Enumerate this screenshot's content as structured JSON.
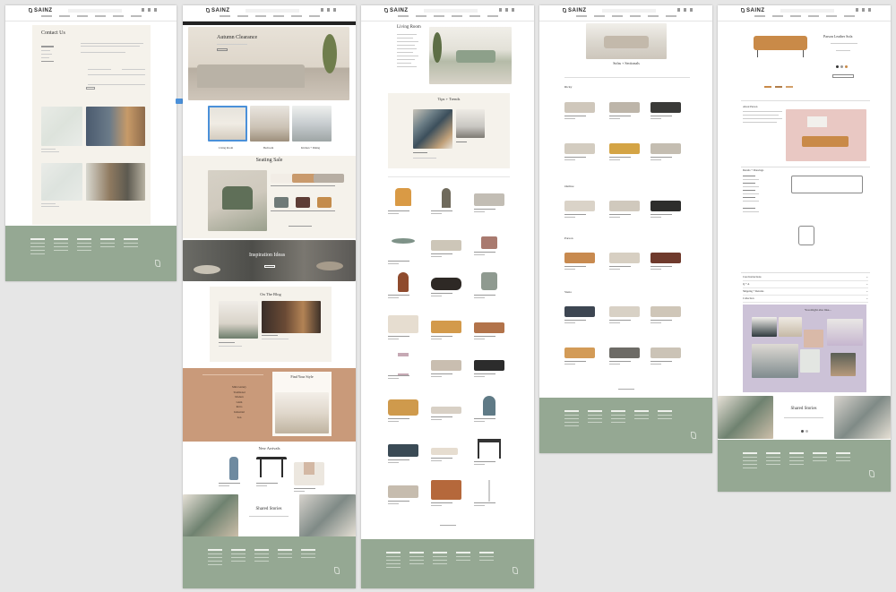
{
  "brand": {
    "name": "SAINZ",
    "footer_color": "#95a893",
    "accent": "#c99a7a"
  },
  "pages": {
    "contact": {
      "title": "Contact Us",
      "form_labels": [
        "Name",
        "Email",
        "Message"
      ]
    },
    "home": {
      "hero_title": "Autumn Clearance",
      "categories": [
        "Living Room",
        "Bedroom",
        "Kitchen + Dining"
      ],
      "seating_title": "Seating Sale",
      "inspiration_title": "Inspiration Ideas",
      "blog_title": "On The Blog",
      "find_style_title": "Find Your Style",
      "style_list": [
        "Mid-Century",
        "Traditional",
        "Modern",
        "Glam",
        "Retro",
        "Industrial",
        "Zen"
      ],
      "new_arrivals_title": "New Arrivals",
      "shared_stories_title": "Shared Stories"
    },
    "living_room": {
      "title": "Living Room",
      "tips_title": "Tips + Trends"
    },
    "sofas": {
      "title": "Sofas + Sectionals",
      "sections": [
        "Ricky",
        "Outline",
        "Parson",
        "Siena"
      ]
    },
    "product": {
      "title": "Parson Leather Sofa",
      "about_title": "About Parson",
      "details_title": "Details + Drawings",
      "accordion": [
        "Care Instructions",
        "Q + A",
        "Shipping + Returns",
        "Collection"
      ],
      "also_like_title": "You might also like...",
      "shared_stories_title": "Shared Stories"
    }
  },
  "icons": {
    "leaf": "leaf-icon",
    "search": "search-icon",
    "user": "user-icon",
    "cart": "cart-icon"
  }
}
